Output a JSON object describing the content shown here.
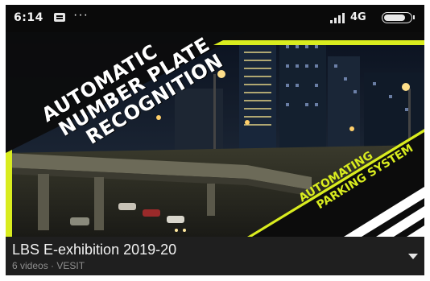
{
  "status_bar": {
    "time": "6:14",
    "more_glyph": "···",
    "network": "4G",
    "battery_level": 0.8,
    "icons": [
      "message-icon",
      "more-icon",
      "signal-icon",
      "battery-icon"
    ]
  },
  "thumbnail": {
    "title_lines": [
      "AUTOMATIC",
      "NUMBER PLATE",
      "RECOGNITION"
    ],
    "tagline_lines": [
      "AUTOMATING",
      "PARKING SYSTEM"
    ],
    "accent_color": "#d9ec1f"
  },
  "playlist": {
    "title": "LBS E-exhibition 2019-20",
    "meta": "6 videos · VESIT"
  },
  "colors": {
    "background": "#121212",
    "info_bar": "#1f1f1f",
    "accent": "#d9ec1f"
  }
}
